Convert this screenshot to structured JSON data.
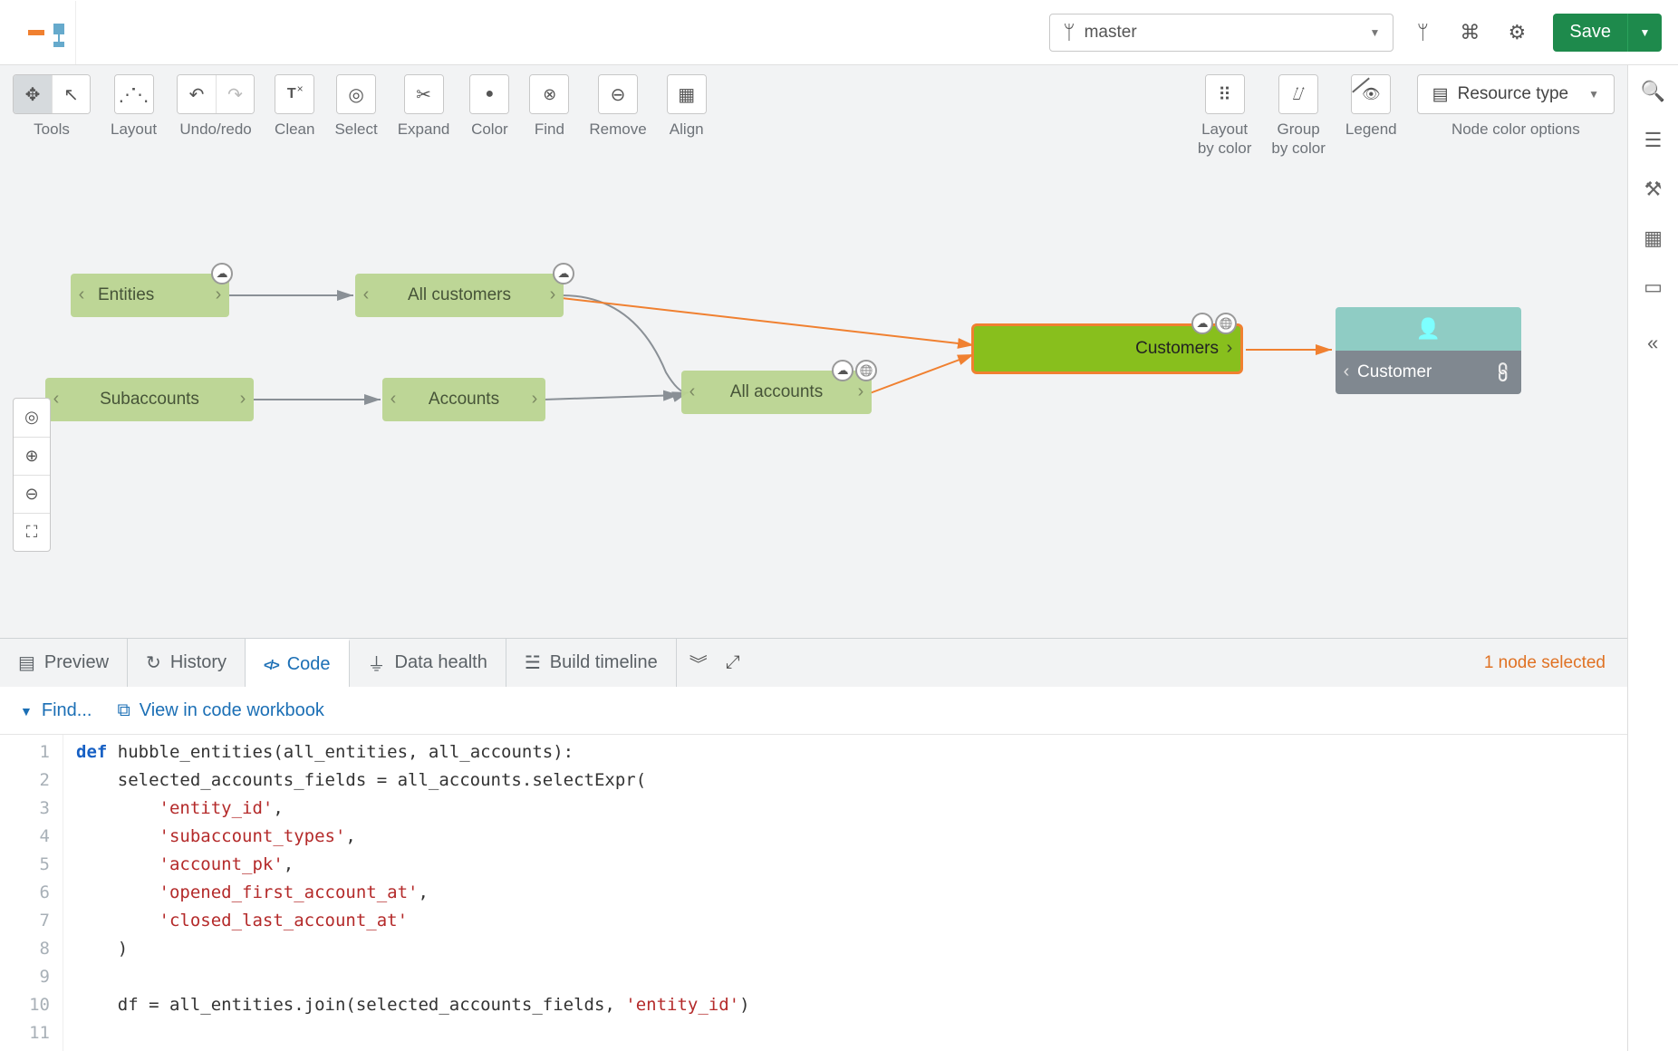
{
  "header": {
    "branch": "master",
    "save_label": "Save"
  },
  "toolbar": {
    "groups": {
      "tools": "Tools",
      "layout": "Layout",
      "undo_redo": "Undo/redo",
      "clean": "Clean",
      "select": "Select",
      "expand": "Expand",
      "color": "Color",
      "find": "Find",
      "remove": "Remove",
      "align": "Align",
      "layout_color": "Layout\nby color",
      "group_color": "Group\nby color",
      "legend": "Legend",
      "node_color": "Node color options"
    },
    "resource_type": "Resource type"
  },
  "graph": {
    "nodes": {
      "entities": "Entities",
      "all_customers": "All customers",
      "subaccounts": "Subaccounts",
      "accounts": "Accounts",
      "all_accounts": "All accounts",
      "customers": "Customers",
      "customer": "Customer"
    }
  },
  "bottom": {
    "tabs": {
      "preview": "Preview",
      "history": "History",
      "code": "Code",
      "data_health": "Data health",
      "build_timeline": "Build timeline"
    },
    "selected": "1 node selected"
  },
  "code_bar": {
    "find": "Find...",
    "view_workbook": "View in code workbook"
  },
  "code": {
    "lines": [
      "def hubble_entities(all_entities, all_accounts):",
      "    selected_accounts_fields = all_accounts.selectExpr(",
      "        'entity_id',",
      "        'subaccount_types',",
      "        'account_pk',",
      "        'opened_first_account_at',",
      "        'closed_last_account_at'",
      "    )",
      "",
      "    df = all_entities.join(selected_accounts_fields, 'entity_id')",
      ""
    ]
  }
}
